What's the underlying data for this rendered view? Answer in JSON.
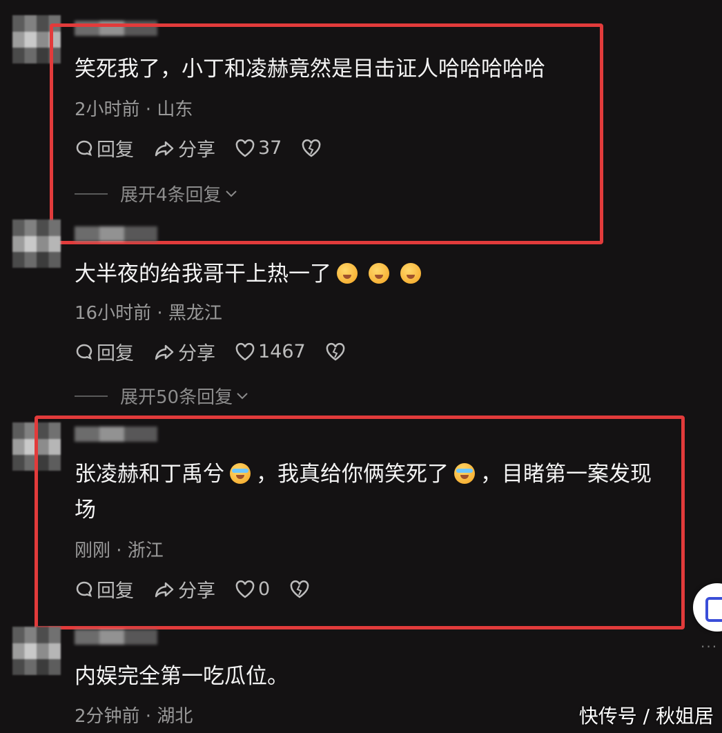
{
  "comments": [
    {
      "text": "笑死我了，小丁和凌赫竟然是目击证人哈哈哈哈哈",
      "meta": "2小时前 · 山东",
      "reply_label": "回复",
      "share_label": "分享",
      "likes": "37",
      "expand": "展开4条回复"
    },
    {
      "text": "大半夜的给我哥干上热一了",
      "meta": "16小时前 · 黑龙江",
      "reply_label": "回复",
      "share_label": "分享",
      "likes": "1467",
      "expand": "展开50条回复"
    },
    {
      "text_a": "张凌赫和丁禹兮",
      "text_b": "，我真给你俩笑死了",
      "text_c": "，目睹第一案发现",
      "text_d": "场",
      "meta": "刚刚 · 浙江",
      "reply_label": "回复",
      "share_label": "分享",
      "likes": "0"
    },
    {
      "text": "内娱完全第一吃瓜位。",
      "meta": "2分钟前 · 湖北"
    }
  ],
  "watermark": "快传号 / 秋姐居",
  "colors": {
    "highlight": "#e23b3b",
    "background": "#141213"
  },
  "icons": [
    "comment-icon",
    "share-icon",
    "heart-icon",
    "broken-heart-icon"
  ]
}
